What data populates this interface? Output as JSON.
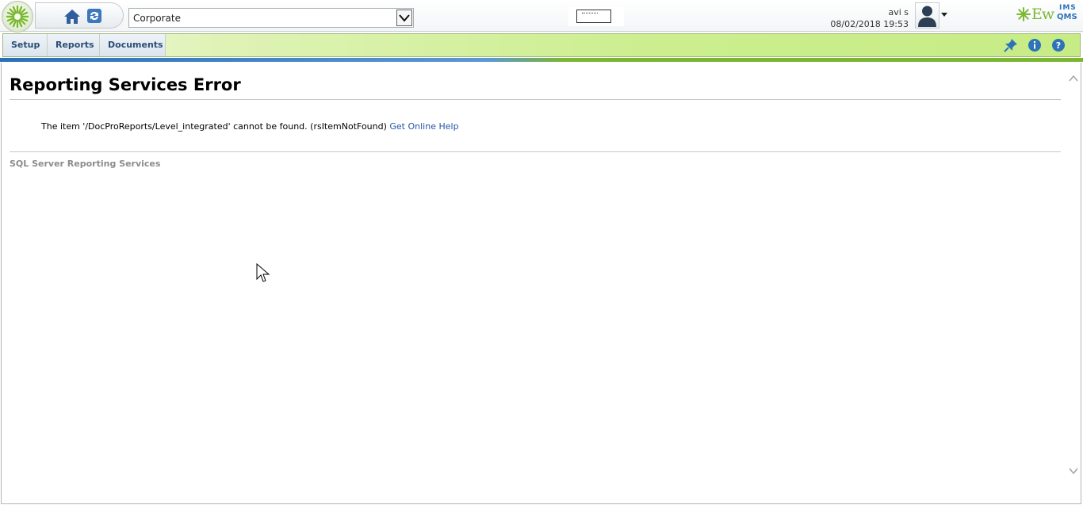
{
  "header": {
    "site_select_value": "Corporate",
    "user_name": "avi s",
    "datetime": "08/02/2018 19:53",
    "brand": {
      "main": "Ew",
      "superscript": "IMS",
      "subscript": "QMS"
    }
  },
  "nav": {
    "tabs": [
      {
        "label": "Setup"
      },
      {
        "label": "Reports"
      },
      {
        "label": "Documents"
      }
    ],
    "icons": [
      "pin-icon",
      "info-icon",
      "help-icon"
    ]
  },
  "content": {
    "title": "Reporting Services Error",
    "message": "The item '/DocProReports/Level_integrated' cannot be found. (rsItemNotFound)",
    "help_link": "Get Online Help",
    "footer": "SQL Server Reporting Services"
  },
  "colors": {
    "accent_green": "#7cb833",
    "accent_blue": "#2c73b8",
    "link": "#2456a8"
  }
}
